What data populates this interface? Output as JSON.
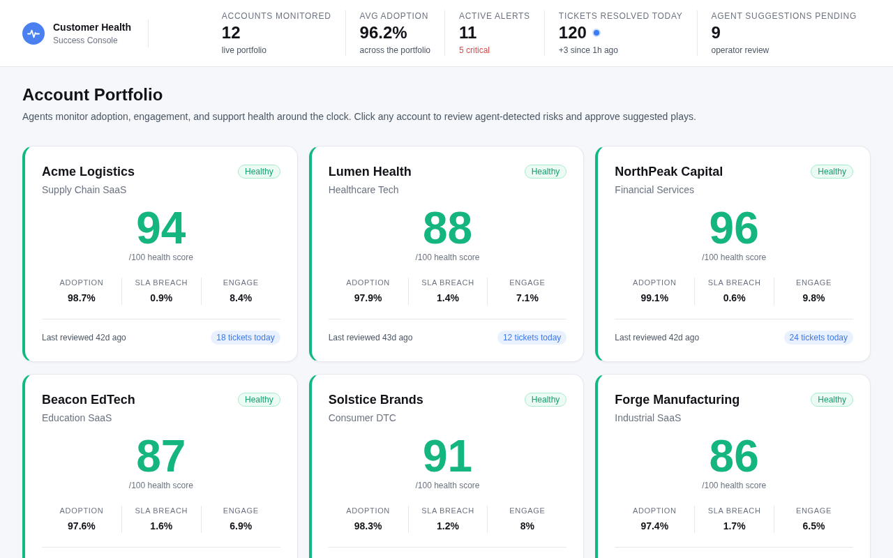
{
  "brand": {
    "title": "Customer Health",
    "subtitle": "Success Console"
  },
  "stats": [
    {
      "kind": "plain",
      "label": "ACCOUNTS MONITORED",
      "value": "12",
      "note": "live portfolio"
    },
    {
      "kind": "plain",
      "label": "AVG ADOPTION",
      "value": "96.2%",
      "note": "across the portfolio"
    },
    {
      "kind": "alert",
      "label": "ACTIVE ALERTS",
      "value": "11",
      "note": "5 critical"
    },
    {
      "kind": "live",
      "label": "TICKETS RESOLVED TODAY",
      "value": "120",
      "note": "+3 since 1h ago"
    },
    {
      "kind": "plain",
      "label": "AGENT SUGGESTIONS PENDING",
      "value": "9",
      "note": "operator review"
    }
  ],
  "page": {
    "title": "Account Portfolio",
    "description": "Agents monitor adoption, engagement, and support health around the clock. Click any account to review agent-detected risks and approve suggested plays."
  },
  "accounts": [
    {
      "name": "Acme Logistics",
      "industry": "Supply Chain SaaS",
      "status": "Healthy",
      "score": "94",
      "score_caption": "/100 health score",
      "metrics": [
        {
          "label": "ADOPTION",
          "value": "98.7%"
        },
        {
          "label": "SLA BREACH",
          "value": "0.9%"
        },
        {
          "label": "ENGAGE",
          "value": "8.4%"
        }
      ],
      "last_reviewed": "Last reviewed 42d ago",
      "tickets": "18 tickets today"
    },
    {
      "name": "Lumen Health",
      "industry": "Healthcare Tech",
      "status": "Healthy",
      "score": "88",
      "score_caption": "/100 health score",
      "metrics": [
        {
          "label": "ADOPTION",
          "value": "97.9%"
        },
        {
          "label": "SLA BREACH",
          "value": "1.4%"
        },
        {
          "label": "ENGAGE",
          "value": "7.1%"
        }
      ],
      "last_reviewed": "Last reviewed 43d ago",
      "tickets": "12 tickets today"
    },
    {
      "name": "NorthPeak Capital",
      "industry": "Financial Services",
      "status": "Healthy",
      "score": "96",
      "score_caption": "/100 health score",
      "metrics": [
        {
          "label": "ADOPTION",
          "value": "99.1%"
        },
        {
          "label": "SLA BREACH",
          "value": "0.6%"
        },
        {
          "label": "ENGAGE",
          "value": "9.8%"
        }
      ],
      "last_reviewed": "Last reviewed 42d ago",
      "tickets": "24 tickets today"
    },
    {
      "name": "Beacon EdTech",
      "industry": "Education SaaS",
      "status": "Healthy",
      "score": "87",
      "score_caption": "/100 health score",
      "metrics": [
        {
          "label": "ADOPTION",
          "value": "97.6%"
        },
        {
          "label": "SLA BREACH",
          "value": "1.6%"
        },
        {
          "label": "ENGAGE",
          "value": "6.9%"
        }
      ]
    },
    {
      "name": "Solstice Brands",
      "industry": "Consumer DTC",
      "status": "Healthy",
      "score": "91",
      "score_caption": "/100 health score",
      "metrics": [
        {
          "label": "ADOPTION",
          "value": "98.3%"
        },
        {
          "label": "SLA BREACH",
          "value": "1.2%"
        },
        {
          "label": "ENGAGE",
          "value": "8%"
        }
      ]
    },
    {
      "name": "Forge Manufacturing",
      "industry": "Industrial SaaS",
      "status": "Healthy",
      "score": "86",
      "score_caption": "/100 health score",
      "metrics": [
        {
          "label": "ADOPTION",
          "value": "97.4%"
        },
        {
          "label": "SLA BREACH",
          "value": "1.7%"
        },
        {
          "label": "ENGAGE",
          "value": "6.5%"
        }
      ]
    }
  ]
}
